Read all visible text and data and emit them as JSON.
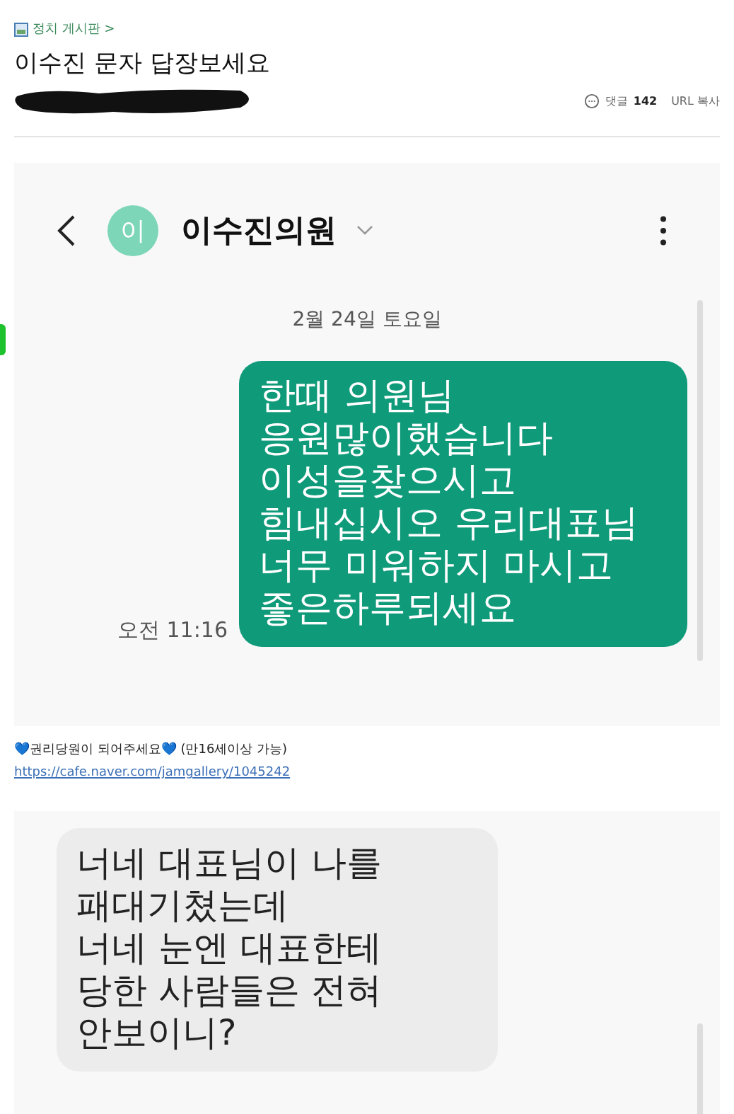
{
  "post": {
    "board": "정치 게시판 >",
    "title": "이수진 문자 답장보세요",
    "comment_label": "댓글",
    "comment_count": "142",
    "url_copy": "URL 복사"
  },
  "screenshot_1": {
    "avatar": "이",
    "contact": "이수진의원",
    "date": "2월 24일 토요일",
    "message": {
      "lines": [
        "한때 의원님",
        "응원많이했습니다",
        "이성을찾으시고",
        "힘내십시오 우리대표님",
        "너무 미워하지 마시고",
        "좋은하루되세요"
      ],
      "time": "오전 11:16"
    }
  },
  "signature": {
    "text": "💙권리당원이 되어주세요💙 (만16세이상 가능)",
    "link": "https://cafe.naver.com/jamgallery/1045242"
  },
  "screenshot_2": {
    "message": {
      "lines": [
        "너네 대표님이 나를",
        "패대기쳤는데",
        "너네 눈엔 대표한테",
        "당한 사람들은 전혀",
        "안보이니?"
      ]
    }
  }
}
